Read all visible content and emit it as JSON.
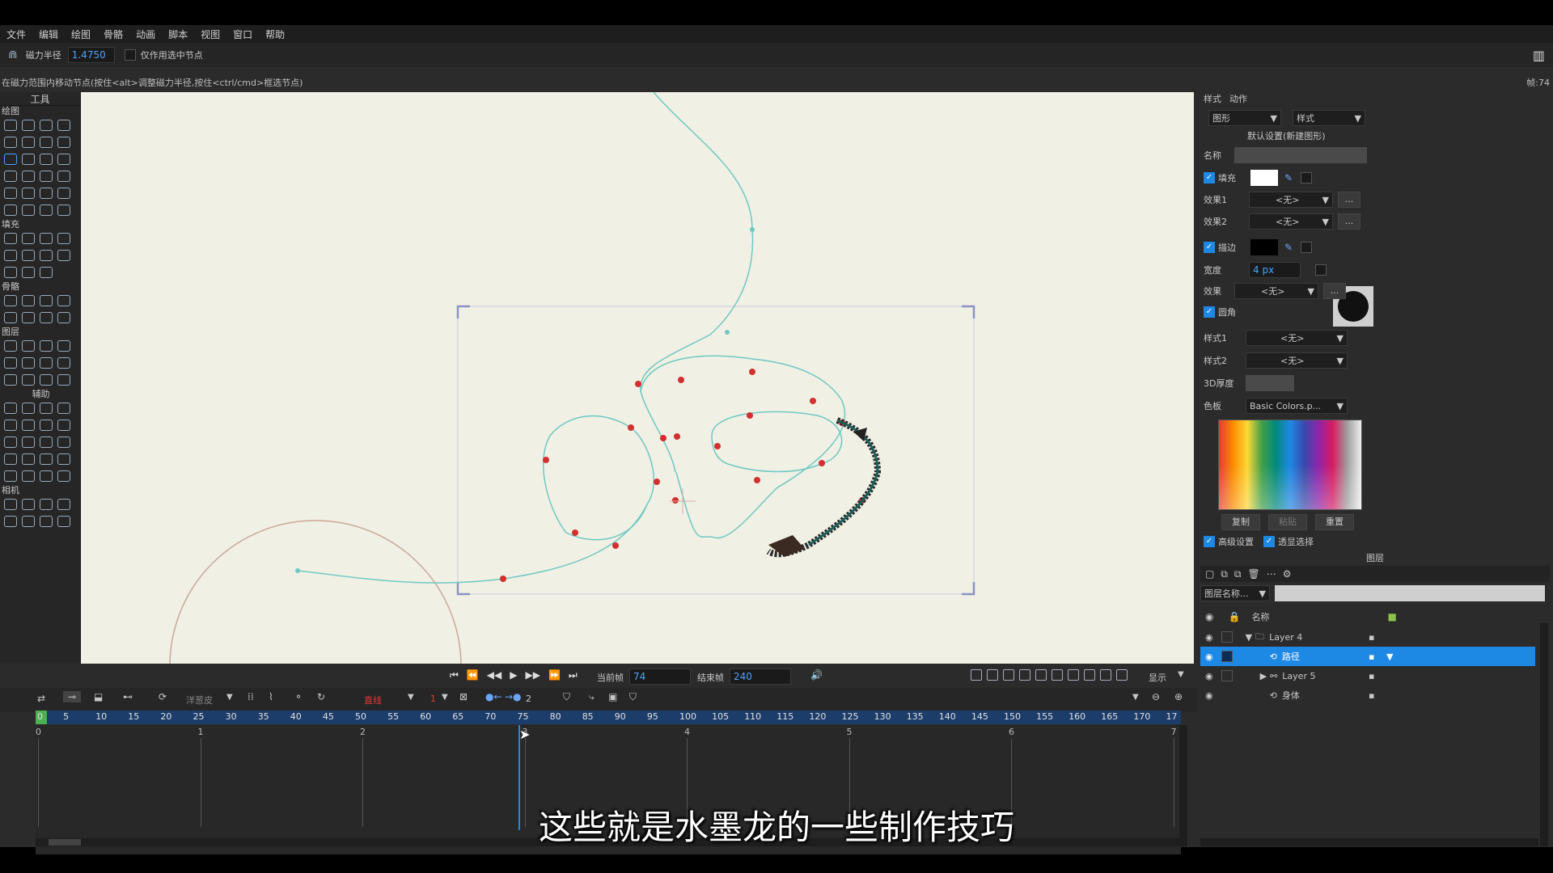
{
  "menu": [
    "文件",
    "编辑",
    "绘图",
    "骨骼",
    "动画",
    "脚本",
    "视图",
    "窗口",
    "帮助"
  ],
  "options": {
    "magnet_label": "磁力半径",
    "magnet_value": "1.4750",
    "selected_only": "仅作用选中节点"
  },
  "hint": {
    "text": "在磁力范围内移动节点(按住<alt>调整磁力半径,按住<ctrl/cmd>框选节点)",
    "frame_info": "帧:74"
  },
  "tools": {
    "title": "工具",
    "sections": [
      "绘图",
      "填充",
      "骨骼",
      "图层",
      "辅助",
      "相机"
    ]
  },
  "style_panel": {
    "tabs": [
      "样式",
      "动作"
    ],
    "shape_dd": "图形",
    "style_dd": "样式",
    "default_label": "默认设置(新建图形)",
    "name_label": "名称",
    "fill_label": "填充",
    "effect1_label": "效果1",
    "effect2_label": "效果2",
    "none": "<无>",
    "ellipsis": "...",
    "stroke_label": "描边",
    "width_label": "宽度",
    "width_value": "4 px",
    "effect_label": "效果",
    "round_label": "圆角",
    "style1_label": "样式1",
    "style2_label": "样式2",
    "depth_label": "3D厚度",
    "palette_label": "色板",
    "palette_value": "Basic Colors.p...",
    "copy": "复制",
    "paste": "粘贴",
    "reset": "重置",
    "advanced": "高级设置",
    "pass_select": "透显选择",
    "fill_color": "#ffffff",
    "stroke_color": "#000000"
  },
  "layers": {
    "title": "图层",
    "name_dd": "图层名称...",
    "col_name": "名称",
    "rows": [
      {
        "name": "Layer 4",
        "selected": false
      },
      {
        "name": "路径",
        "selected": true
      },
      {
        "name": "Layer 5",
        "selected": false
      },
      {
        "name": "身体",
        "selected": false
      }
    ]
  },
  "playback": {
    "current_label": "当前帧",
    "current_value": "74",
    "end_label": "结束帧",
    "end_value": "240",
    "display": "显示"
  },
  "timeline": {
    "onion": "洋葱皮",
    "interp": "直线",
    "frame_num": "1",
    "step": "2",
    "ruler": [
      "0",
      "5",
      "10",
      "15",
      "20",
      "25",
      "30",
      "35",
      "40",
      "45",
      "50",
      "55",
      "60",
      "65",
      "70",
      "75",
      "80",
      "85",
      "90",
      "95",
      "100",
      "105",
      "110",
      "115",
      "120",
      "125",
      "130",
      "135",
      "140",
      "145",
      "150",
      "155",
      "160",
      "165",
      "170",
      "17"
    ],
    "seconds": [
      "0",
      "1",
      "2",
      "3",
      "4",
      "5",
      "6",
      "7"
    ]
  },
  "subtitle": "这些就是水墨龙的一些制作技巧",
  "colors": {
    "accent": "#1e88e5",
    "canvas": "#f1f0e4",
    "curve": "#6ec8c4",
    "point": "#d32f2f",
    "ruler": "#1c3c6a"
  }
}
